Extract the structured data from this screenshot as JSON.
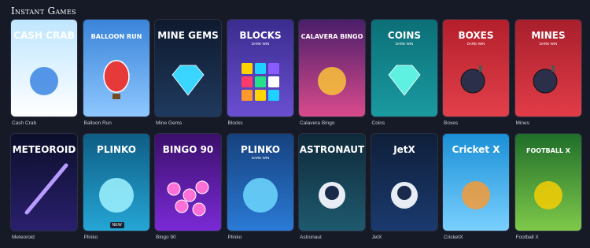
{
  "section": {
    "title": "Instant Games"
  },
  "games": [
    {
      "name": "Cash Crab",
      "logo": "CASH CRAB",
      "bg": [
        "#bfe6ff",
        "#ffffff"
      ],
      "accent": "#2f7de1"
    },
    {
      "name": "Balloon Run",
      "logo": "BALLOON RUN",
      "bg": [
        "#3a84d9",
        "#8ec7ff"
      ],
      "accent": "#e63a3a"
    },
    {
      "name": "Mine Gems",
      "logo": "MINE GEMS",
      "bg": [
        "#0f1a2e",
        "#1f3a5e"
      ],
      "accent": "#3ad6ff"
    },
    {
      "name": "Blocks",
      "logo": "BLOCKS",
      "sublogo": "DARE·WIN",
      "bg": [
        "#3a2c8e",
        "#6a4fd1"
      ],
      "accent": "#ffd400"
    },
    {
      "name": "Calavera Bingo",
      "logo": "CALAVERA BINGO",
      "bg": [
        "#4a1e6a",
        "#d94a8c"
      ],
      "accent": "#ffcc33"
    },
    {
      "name": "Coins",
      "logo": "COINS",
      "sublogo": "DARE·WIN",
      "bg": [
        "#0c6f77",
        "#1a9aa0"
      ],
      "accent": "#5ef0e0"
    },
    {
      "name": "Boxes",
      "logo": "BOXES",
      "sublogo": "DARE·WIN",
      "bg": [
        "#b31f2b",
        "#e2404a"
      ],
      "accent": "#2b2f4a"
    },
    {
      "name": "Mines",
      "logo": "MINES",
      "sublogo": "DARE·WIN",
      "bg": [
        "#a81f2c",
        "#e13c47"
      ],
      "accent": "#2b2f4a"
    },
    {
      "name": "Meteoroid",
      "logo": "METEOROID",
      "bg": [
        "#0b0f2a",
        "#2a1f6e"
      ],
      "accent": "#b79bff"
    },
    {
      "name": "Plinko",
      "logo": "PLINKO",
      "badge": "NEW",
      "bg": [
        "#0e5d84",
        "#25a6d6"
      ],
      "accent": "#9ff3ff"
    },
    {
      "name": "Bingo 90",
      "logo": "BINGO 90",
      "bg": [
        "#3b0f6b",
        "#7a2ad6"
      ],
      "accent": "#ff6fd8"
    },
    {
      "name": "Plinko",
      "logo": "PLINKO",
      "sublogo": "DARE·WIN",
      "bg": [
        "#16417e",
        "#2a7ad6"
      ],
      "accent": "#6fd8ff"
    },
    {
      "name": "Astronaut",
      "logo": "ASTRONAUT",
      "bg": [
        "#0e2a3a",
        "#1f5a6e"
      ],
      "accent": "#ff5a3a"
    },
    {
      "name": "JetX",
      "logo": "JetX",
      "bg": [
        "#0f1f3a",
        "#1a3a6e"
      ],
      "accent": "#ffd000"
    },
    {
      "name": "CricketX",
      "logo": "Cricket X",
      "bg": [
        "#1a8fd6",
        "#7ad0ff"
      ],
      "accent": "#ff9a2a"
    },
    {
      "name": "Football X",
      "logo": "FOOTBALL X",
      "bg": [
        "#1f6e2a",
        "#7fc94a"
      ],
      "accent": "#ffd000"
    }
  ]
}
